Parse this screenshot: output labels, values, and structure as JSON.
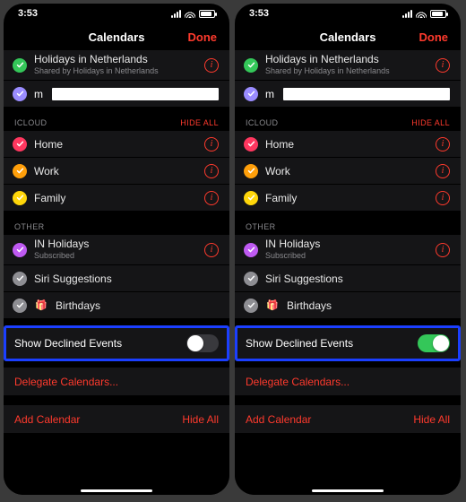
{
  "status": {
    "time": "3:53"
  },
  "nav": {
    "title": "Calendars",
    "done": "Done"
  },
  "top_group": {
    "items": [
      {
        "label": "Holidays in Netherlands",
        "subtitle": "Shared by Holidays in Netherlands",
        "color": "#34c759",
        "info": true
      },
      {
        "label": "m",
        "redacted": true,
        "color": "#9a8cff",
        "info": false
      }
    ]
  },
  "icloud": {
    "header": "ICLOUD",
    "action": "HIDE ALL",
    "items": [
      {
        "label": "Home",
        "color": "#ff375f",
        "info": true
      },
      {
        "label": "Work",
        "color": "#ff9f0a",
        "info": true
      },
      {
        "label": "Family",
        "color": "#ffd60a",
        "info": true
      }
    ]
  },
  "other": {
    "header": "OTHER",
    "items": [
      {
        "label": "IN Holidays",
        "subtitle": "Subscribed",
        "color": "#bf5af2",
        "info": true
      },
      {
        "label": "Siri Suggestions",
        "color": "#8e8e93",
        "info": false
      },
      {
        "label": "Birthdays",
        "icon": "gift",
        "color": "#8e8e93",
        "info": false
      }
    ]
  },
  "toggle": {
    "label": "Show Declined Events",
    "left_state": false,
    "right_state": true
  },
  "links": {
    "delegate": "Delegate Calendars...",
    "add": "Add Calendar",
    "hide_all": "Hide All"
  }
}
